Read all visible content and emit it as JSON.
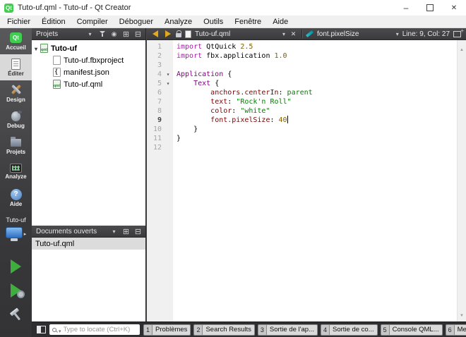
{
  "window": {
    "title": "Tuto-uf.qml - Tuto-uf - Qt Creator",
    "controls": [
      "minimize",
      "maximize",
      "close"
    ]
  },
  "menu": {
    "items": [
      "Fichier",
      "Édition",
      "Compiler",
      "Déboguer",
      "Analyze",
      "Outils",
      "Fenêtre",
      "Aide"
    ]
  },
  "sidebar": {
    "modes": [
      {
        "id": "accueil",
        "label": "Accueil",
        "active": false
      },
      {
        "id": "editer",
        "label": "Éditer",
        "active": true
      },
      {
        "id": "design",
        "label": "Design",
        "active": false
      },
      {
        "id": "debug",
        "label": "Debug",
        "active": false
      },
      {
        "id": "projets",
        "label": "Projets",
        "active": false
      },
      {
        "id": "analyze",
        "label": "Analyze",
        "active": false
      },
      {
        "id": "aide",
        "label": "Aide",
        "active": false
      }
    ],
    "target_name": "Tuto-uf"
  },
  "projects_pane": {
    "title": "Projets",
    "root": {
      "label": "Tuto-uf",
      "icon": "qmlproj",
      "expanded": true
    },
    "children": [
      {
        "label": "Tuto-uf.fbxproject",
        "icon": "file"
      },
      {
        "label": "manifest.json",
        "icon": "json"
      },
      {
        "label": "Tuto-uf.qml",
        "icon": "qml"
      }
    ]
  },
  "open_documents_pane": {
    "title": "Documents ouverts",
    "items": [
      {
        "label": "Tuto-uf.qml",
        "selected": true
      }
    ]
  },
  "editor": {
    "doc_tab": "Tuto-uf.qml",
    "symbol": "font.pixelSize",
    "cursor_position": "Line: 9, Col: 27",
    "lines": [
      {
        "n": 1,
        "tokens": [
          {
            "t": "kw",
            "s": "import "
          },
          {
            "t": "pl",
            "s": "QtQuick "
          },
          {
            "t": "num",
            "s": "2.5"
          }
        ]
      },
      {
        "n": 2,
        "tokens": [
          {
            "t": "kw",
            "s": "import "
          },
          {
            "t": "pl",
            "s": "fbx.application "
          },
          {
            "t": "num",
            "s": "1.0"
          }
        ]
      },
      {
        "n": 3,
        "tokens": []
      },
      {
        "n": 4,
        "fold": true,
        "tokens": [
          {
            "t": "type",
            "s": "Application"
          },
          {
            "t": "pl",
            "s": " {"
          }
        ]
      },
      {
        "n": 5,
        "fold": true,
        "tokens": [
          {
            "t": "pl",
            "s": "    "
          },
          {
            "t": "type",
            "s": "Text"
          },
          {
            "t": "pl",
            "s": " {"
          }
        ]
      },
      {
        "n": 6,
        "tokens": [
          {
            "t": "pl",
            "s": "        "
          },
          {
            "t": "prop",
            "s": "anchors.centerIn"
          },
          {
            "t": "pl",
            "s": ": "
          },
          {
            "t": "val",
            "s": "parent"
          }
        ]
      },
      {
        "n": 7,
        "tokens": [
          {
            "t": "pl",
            "s": "        "
          },
          {
            "t": "prop",
            "s": "text"
          },
          {
            "t": "pl",
            "s": ": "
          },
          {
            "t": "str",
            "s": "\"Rock'n Roll\""
          }
        ]
      },
      {
        "n": 8,
        "tokens": [
          {
            "t": "pl",
            "s": "        "
          },
          {
            "t": "prop",
            "s": "color"
          },
          {
            "t": "pl",
            "s": ": "
          },
          {
            "t": "str",
            "s": "\"white\""
          }
        ]
      },
      {
        "n": 9,
        "current": true,
        "cursor": true,
        "tokens": [
          {
            "t": "pl",
            "s": "        "
          },
          {
            "t": "prop",
            "s": "font.pixelSize"
          },
          {
            "t": "pl",
            "s": ": "
          },
          {
            "t": "num",
            "s": "40"
          }
        ]
      },
      {
        "n": 10,
        "tokens": [
          {
            "t": "pl",
            "s": "    }"
          }
        ]
      },
      {
        "n": 11,
        "tokens": [
          {
            "t": "pl",
            "s": "}"
          }
        ]
      },
      {
        "n": 12,
        "tokens": []
      }
    ]
  },
  "statusbar": {
    "locator_placeholder": "Type to locate (Ctrl+K)",
    "panes": [
      {
        "index": "1",
        "label": "Problèmes"
      },
      {
        "index": "2",
        "label": "Search Results"
      },
      {
        "index": "3",
        "label": "Sortie de l'ap..."
      },
      {
        "index": "4",
        "label": "Sortie de co..."
      },
      {
        "index": "5",
        "label": "Console QML..."
      },
      {
        "index": "6",
        "label": "Messages gé..."
      }
    ]
  },
  "colors": {
    "syntax": {
      "keyword": "#a818a8",
      "type": "#800080",
      "property": "#800000",
      "string": "#008000",
      "number": "#806000",
      "value": "#008000",
      "plain": "#000000"
    },
    "accent_run": "#3fae3f",
    "accent_gold": "#e2a81f",
    "accent_kit": "#2f6fc2",
    "qt_green": "#41cd52"
  }
}
